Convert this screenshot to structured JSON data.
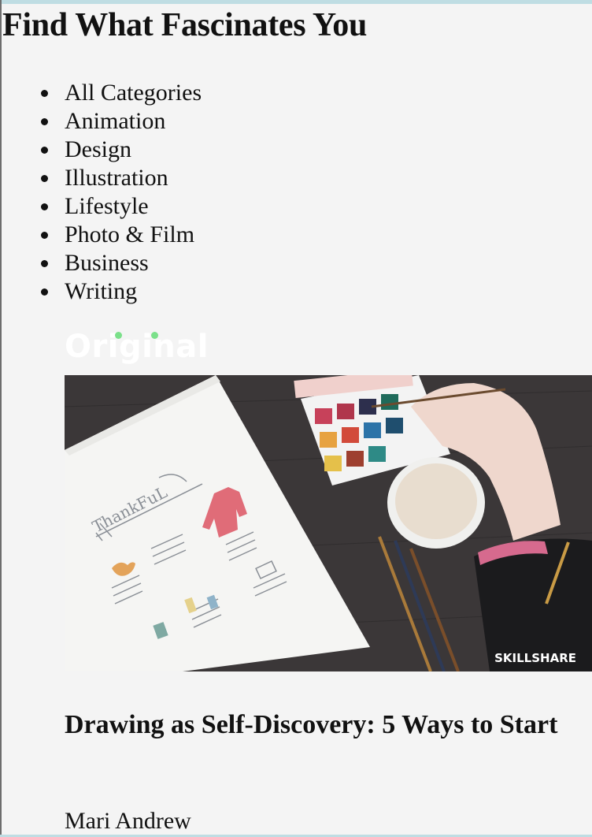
{
  "page": {
    "title": "Find What Fascinates You"
  },
  "categories": [
    {
      "label": "All Categories"
    },
    {
      "label": "Animation"
    },
    {
      "label": "Design"
    },
    {
      "label": "Illustration"
    },
    {
      "label": "Lifestyle"
    },
    {
      "label": "Photo & Film"
    },
    {
      "label": "Business"
    },
    {
      "label": "Writing"
    }
  ],
  "course": {
    "badge": "Original",
    "image_watermark": "SKILLSHARE",
    "title": "Drawing as Self-Discovery: 5 Ways to Start",
    "author": "Mari Andrew"
  },
  "colors": {
    "background": "#f4f4f4",
    "accent_border": "#bfdde3",
    "badge_dot": "#7be08a",
    "badge_text": "#ffffff"
  }
}
